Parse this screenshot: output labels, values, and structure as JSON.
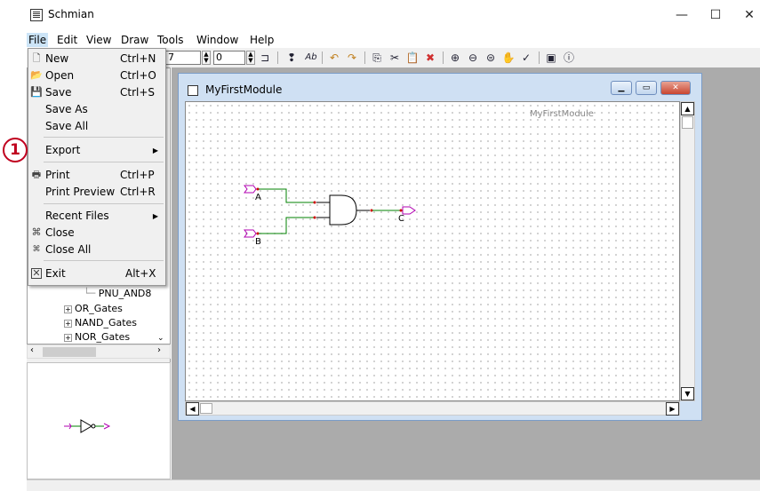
{
  "window": {
    "title": "Schmian",
    "minimize": "—",
    "maximize": "☐",
    "close": "✕"
  },
  "menubar": {
    "items": [
      "File",
      "Edit",
      "View",
      "Draw",
      "Tools",
      "Window",
      "Help"
    ]
  },
  "toolbar": {
    "field1": "7",
    "field2": "0"
  },
  "file_menu": {
    "new": {
      "label": "New",
      "shortcut": "Ctrl+N"
    },
    "open": {
      "label": "Open",
      "shortcut": "Ctrl+O"
    },
    "save": {
      "label": "Save",
      "shortcut": "Ctrl+S"
    },
    "save_as": {
      "label": "Save As"
    },
    "save_all": {
      "label": "Save All"
    },
    "export": {
      "label": "Export"
    },
    "print": {
      "label": "Print",
      "shortcut": "Ctrl+P"
    },
    "print_preview": {
      "label": "Print Preview",
      "shortcut": "Ctrl+R"
    },
    "recent_files": {
      "label": "Recent Files"
    },
    "close": {
      "label": "Close"
    },
    "close_all": {
      "label": "Close All"
    },
    "exit": {
      "label": "Exit",
      "shortcut": "Alt+X"
    }
  },
  "annotation": {
    "marker": "1"
  },
  "tree": {
    "items": [
      "PNU_AND8",
      "OR_Gates",
      "NAND_Gates",
      "NOR_Gates"
    ]
  },
  "document": {
    "title": "MyFirstModule",
    "module_label": "MyFirstModule",
    "pins": {
      "input_a": "A",
      "input_b": "B",
      "output_c": "C"
    }
  },
  "colors": {
    "wire": "#008000",
    "port": "#b000b0",
    "pin_dot": "#cc0000",
    "annotation": "#c0001f"
  }
}
